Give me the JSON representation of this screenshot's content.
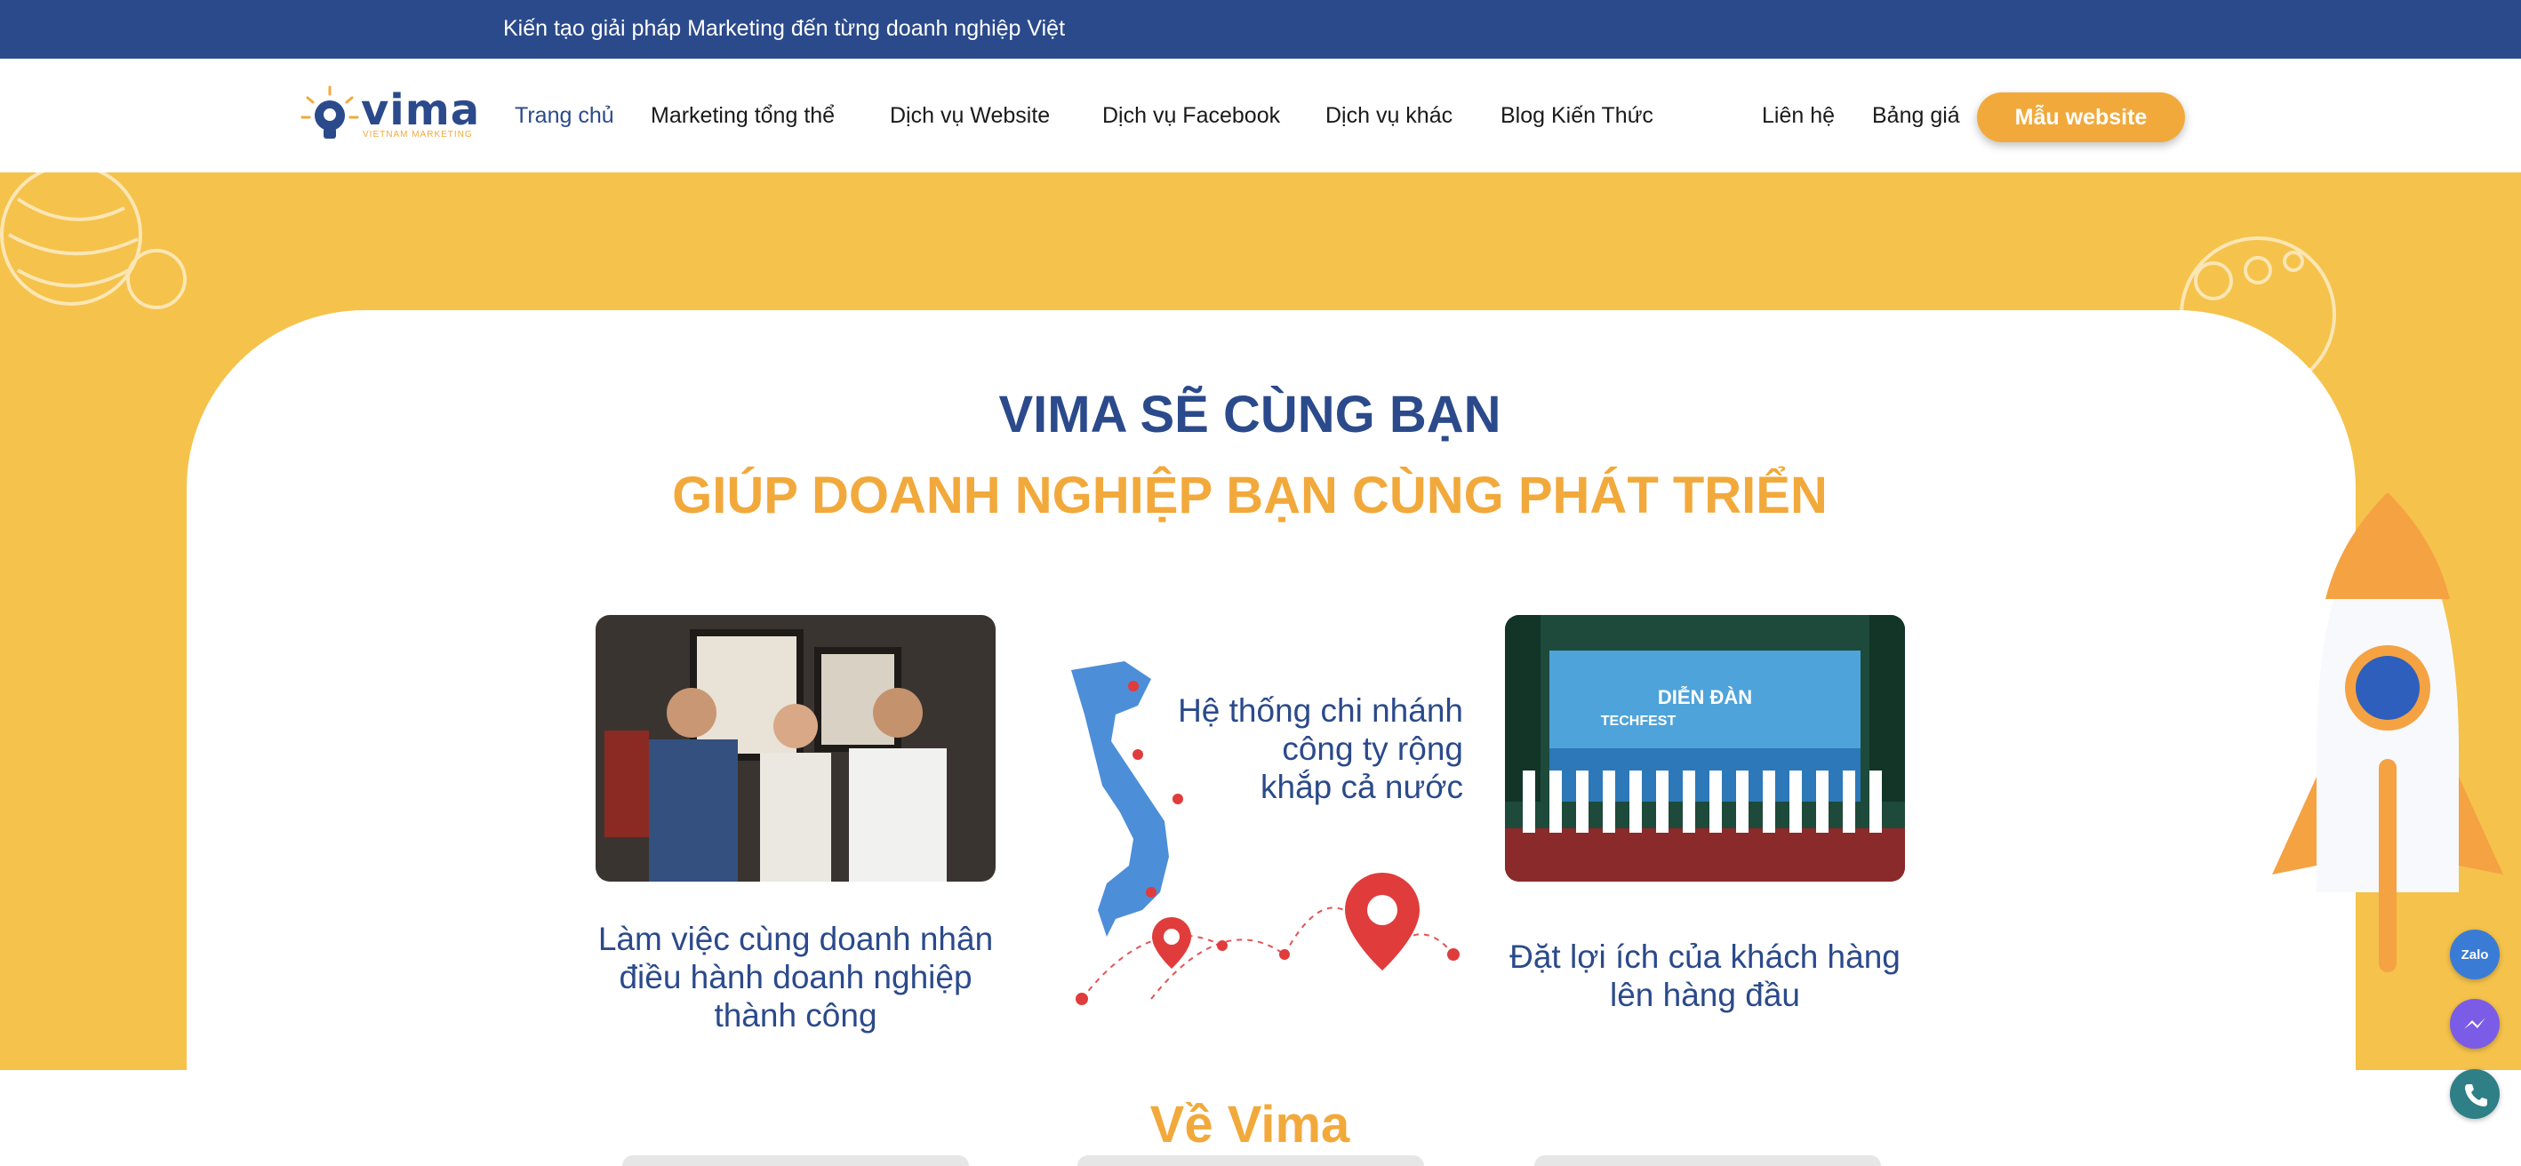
{
  "topbar": {
    "tagline": "Kiến tạo giải pháp Marketing đến từng doanh nghiệp Việt"
  },
  "logo": {
    "word": "vima",
    "sub": "VIETNAM MARKETING"
  },
  "nav": {
    "items": [
      {
        "label": "Trang chủ"
      },
      {
        "label": "Marketing tổng thể"
      },
      {
        "label": "Dịch vụ Website"
      },
      {
        "label": "Dịch vụ Facebook"
      },
      {
        "label": "Dịch vụ khác"
      },
      {
        "label": "Blog Kiến Thức"
      },
      {
        "label": "Liên hệ"
      },
      {
        "label": "Bảng giá"
      }
    ],
    "cta": "Mẫu website"
  },
  "hero": {
    "title_line1": "VIMA SẼ CÙNG BẠN",
    "title_line2": "GIÚP DOANH NGHIỆP BẠN CÙNG PHÁT TRIỂN",
    "left_caption": [
      "Làm việc cùng doanh nhân",
      "điều hành doanh nghiệp",
      "thành công"
    ],
    "center_caption": [
      "Hệ thống chi nhánh",
      "công ty rộng",
      "khắp cả nước"
    ],
    "right_caption": [
      "Đặt lợi ích của khách hàng",
      "lên hàng đầu"
    ],
    "event_banner": {
      "line1": "DIỄN ĐÀN",
      "line2": "TECHFEST"
    }
  },
  "about": {
    "title": "Về Vima"
  },
  "floating": {
    "zalo_label": "Zalo"
  },
  "colors": {
    "navy": "#2b4a8b",
    "orange": "#f2a93b",
    "yellow": "#f5c24b"
  }
}
